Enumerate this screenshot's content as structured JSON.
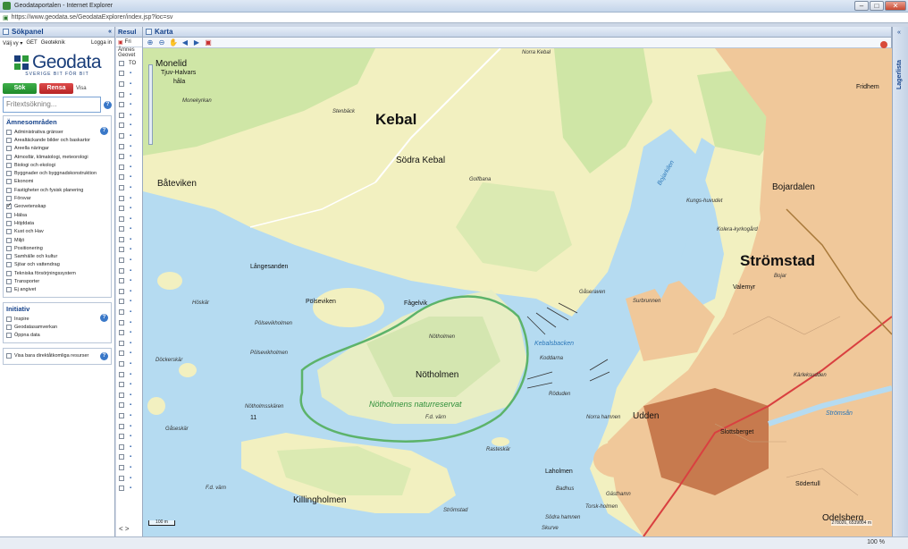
{
  "window": {
    "title": "Geodataportalen - Internet Explorer",
    "url": "https://www.geodata.se/GeodataExplorer/index.jsp?loc=sv"
  },
  "left_panel": {
    "title": "Sökpanel",
    "menu": [
      "Välj vy ▾",
      "GET",
      "Geoteknik"
    ],
    "login": "Logga in",
    "brand": {
      "name": "Geodata",
      "tagline": "SVERIGE BIT FÖR BIT"
    },
    "buttons": {
      "search": "Sök",
      "clear": "Rensa",
      "show": "Visa"
    },
    "search": {
      "placeholder": "Fritextsökning..."
    },
    "topics": {
      "title": "Ämnesområden",
      "items": [
        {
          "label": "Administrativa gränser",
          "checked": false
        },
        {
          "label": "Arealtäckande bilder och baskartor",
          "checked": false
        },
        {
          "label": "Areella näringar",
          "checked": false
        },
        {
          "label": "Atmosfär, klimatologi, meteorologi",
          "checked": false
        },
        {
          "label": "Biologi och ekologi",
          "checked": false
        },
        {
          "label": "Byggnader och byggnadskonstruktion",
          "checked": false
        },
        {
          "label": "Ekonomi",
          "checked": false
        },
        {
          "label": "Fastigheter och fysisk planering",
          "checked": false
        },
        {
          "label": "Försvar",
          "checked": false
        },
        {
          "label": "Geovetenskap",
          "checked": true
        },
        {
          "label": "Hälsa",
          "checked": false
        },
        {
          "label": "Höjddata",
          "checked": false
        },
        {
          "label": "Kust och Hav",
          "checked": false
        },
        {
          "label": "Miljö",
          "checked": false
        },
        {
          "label": "Positionering",
          "checked": false
        },
        {
          "label": "Samhälle och kultur",
          "checked": false
        },
        {
          "label": "Sjöar och vattendrag",
          "checked": false
        },
        {
          "label": "Tekniska försörjningssystem",
          "checked": false
        },
        {
          "label": "Transporter",
          "checked": false
        },
        {
          "label": "Ej angivet",
          "checked": false
        }
      ]
    },
    "initiatives": {
      "title": "Initiativ",
      "items": [
        {
          "label": "Inspire",
          "checked": false
        },
        {
          "label": "Geodatasamverkan",
          "checked": false
        },
        {
          "label": "Öppna data",
          "checked": false
        }
      ]
    },
    "direct_only": {
      "label": "Visa bara direktåtkomliga resurser",
      "checked": false
    }
  },
  "result_panel": {
    "title": "Resul",
    "toolbar_text": "Fri",
    "sub1": "Ämnes",
    "sub2": "Geovet",
    "header_cell": "TO",
    "row_count": 41,
    "nav": "< >"
  },
  "map_panel": {
    "title": "Karta",
    "tools": [
      "zoom-in",
      "zoom-out",
      "pan",
      "previous",
      "next",
      "pdf"
    ],
    "scale": "100 m",
    "coords": "278026, 6539004 m",
    "labels": {
      "monelid": "Monelid",
      "tjuv": "Tjuv-Halvars",
      "hala": "håla",
      "monekyrkan": "Monekyrkan",
      "stenback": "Stenbäck",
      "kebal": "Kebal",
      "sodra_kebal": "Södra Kebal",
      "golfbana": "Golfbana",
      "bateviken": "Båteviken",
      "langesanden": "Långesanden",
      "hoskar": "Höskär",
      "polseviken": "Pölseviken",
      "fagelvik": "Fågelvik",
      "polsevikholmen1": "Pölsevikholmen",
      "polsevikholmen2": "Pölsevikholmen",
      "dockerskar": "Döckerskär",
      "notholmen": "Nötholmen",
      "notholmen_small": "Nötholmen",
      "reserve": "Nötholmens naturreservat",
      "notholmsskaren": "Nötholmsskären",
      "fd_varn": "F.d. värn",
      "gaseskar": "Gåseskär",
      "fd_varn2": "F.d. värn",
      "killingholmen": "Killingholmen",
      "stromstad_small": "Strömstad",
      "rasteskar": "Rasteskär",
      "laholmen": "Laholmen",
      "badhus": "Badhus",
      "gasthamn": "Gästhamn",
      "sodra_hamnen": "Södra hamnen",
      "norra_hamnen": "Norra hamnen",
      "udden": "Udden",
      "slottsberget": "Slottsberget",
      "sodertull": "Södertull",
      "odelsberg": "Odelsberg",
      "stromstad": "Strömstad",
      "valemyr": "Valemyr",
      "bojar": "Bojar",
      "bojardalen": "Bojardalen",
      "kungshuvudet": "Kungs-huvudet",
      "kolerakyrkogard": "Kolera-kyrkogård",
      "bojarkilen": "Bojarkilen",
      "gasavan": "Gåseraven",
      "surbrunnen": "Surbrunnen",
      "kebalsbacken": "Kebalsbacken",
      "koddarna": "Koddarna",
      "roduden": "Röduden",
      "kareksudden": "Kärleksudden",
      "stromsan": "Strömsån",
      "fridhem": "Fridhem",
      "norra_kebal": "Norra Kebal",
      "skurve": "Skurve",
      "torskholmen": "Torsk-holmen",
      "num11": "11"
    }
  },
  "right_strip": {
    "label": "Lagerlista"
  },
  "status": {
    "zoom": "100 %"
  }
}
